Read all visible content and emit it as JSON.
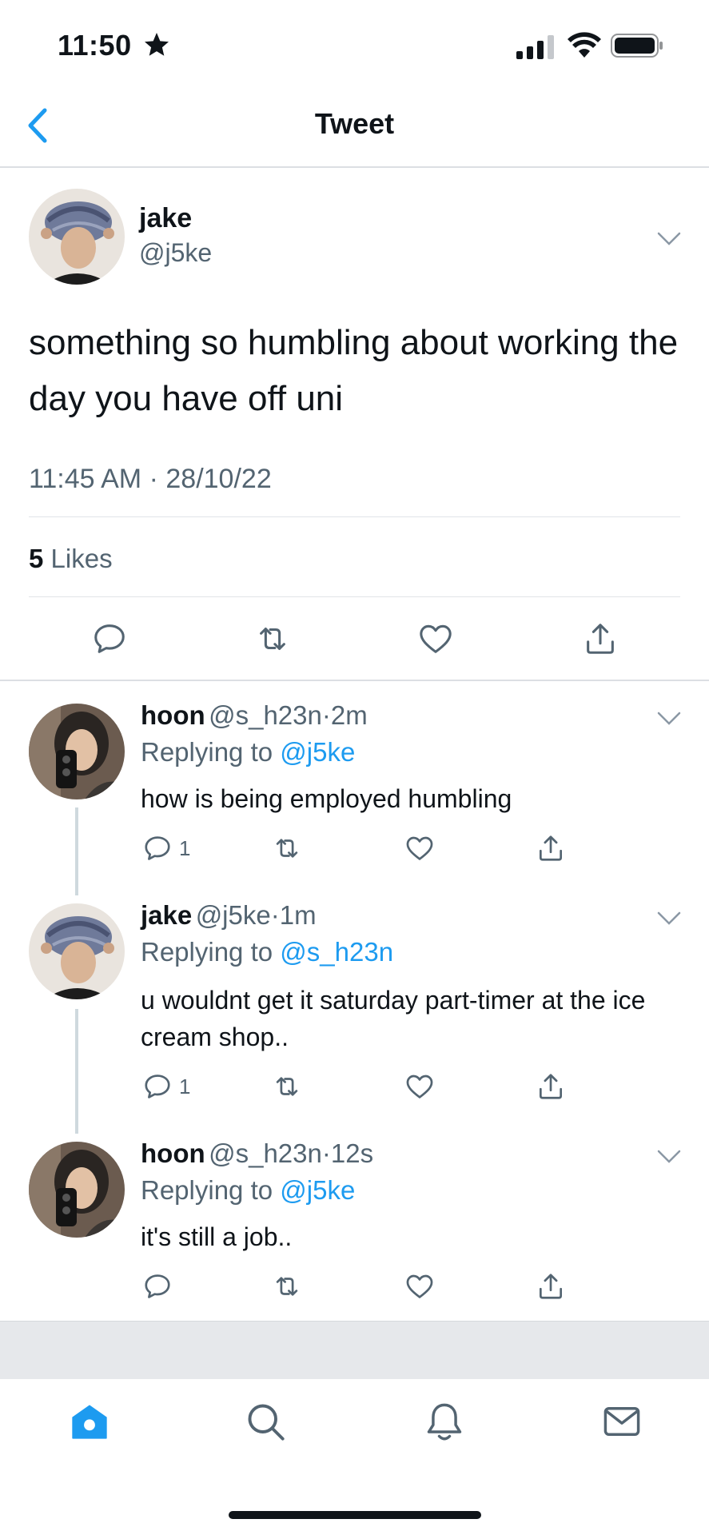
{
  "status_bar": {
    "time": "11:50"
  },
  "header": {
    "title": "Tweet"
  },
  "main_tweet": {
    "name": "jake",
    "handle": "@j5ke",
    "text": "something so humbling about working the day you have off uni",
    "time": "11:45 AM",
    "separator": "·",
    "date": "28/10/22",
    "likes_count": "5",
    "likes_label": "Likes"
  },
  "replies": [
    {
      "name": "hoon",
      "handle": "@s_h23n",
      "time": "2m",
      "replying_prefix": "Replying to",
      "replying_to": "@j5ke",
      "text": "how is being employed humbling",
      "reply_count": "1"
    },
    {
      "name": "jake",
      "handle": "@j5ke",
      "time": "1m",
      "replying_prefix": "Replying to",
      "replying_to": "@s_h23n",
      "text": "u wouldnt get it saturday part-timer at the ice cream shop..",
      "reply_count": "1"
    },
    {
      "name": "hoon",
      "handle": "@s_h23n",
      "time": "12s",
      "replying_prefix": "Replying to",
      "replying_to": "@j5ke",
      "text": "it's still a job..",
      "reply_count": ""
    }
  ],
  "tab_bar": {
    "active": "home",
    "items": [
      "home",
      "search",
      "notifications",
      "messages"
    ]
  },
  "colors": {
    "accent": "#1d9bf0",
    "secondary_text": "#536471"
  }
}
